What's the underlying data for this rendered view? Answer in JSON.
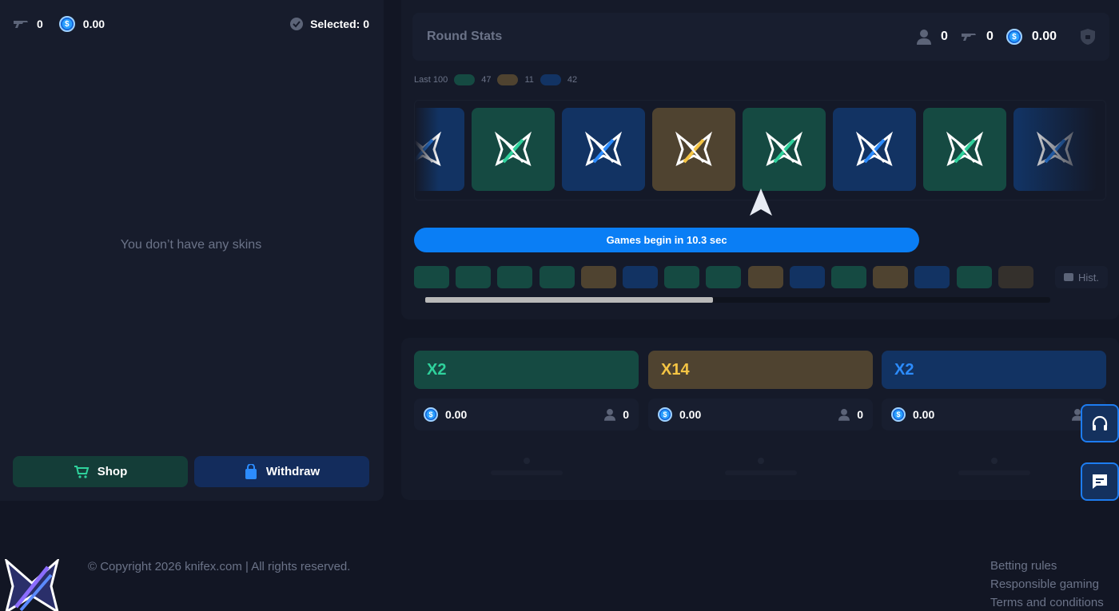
{
  "inventory": {
    "skins_count": "0",
    "balance": "0.00",
    "selected_label": "Selected: 0",
    "empty_message": "You don’t have any skins",
    "shop_label": "Shop",
    "withdraw_label": "Withdraw"
  },
  "round_stats": {
    "title": "Round Stats",
    "players": "0",
    "skins": "0",
    "total": "0.00"
  },
  "last100": {
    "label": "Last 100",
    "green": "47",
    "gold": "11",
    "blue": "42"
  },
  "roulette": {
    "tiles": [
      "blue",
      "green",
      "blue",
      "gold",
      "green",
      "blue",
      "green",
      "blue"
    ]
  },
  "countdown": {
    "text": "Games begin in 10.3 sec",
    "progress_percent": 73
  },
  "history": {
    "chips": [
      "green",
      "green",
      "green",
      "green",
      "gold",
      "blue",
      "green",
      "green",
      "gold",
      "blue",
      "green",
      "gold",
      "blue",
      "green",
      "gold"
    ],
    "button_label": "Hist."
  },
  "bets": [
    {
      "multiplier": "X2",
      "amount": "0.00",
      "players": "0",
      "color": "green"
    },
    {
      "multiplier": "X14",
      "amount": "0.00",
      "players": "0",
      "color": "gold"
    },
    {
      "multiplier": "X2",
      "amount": "0.00",
      "players": "0",
      "color": "blue"
    }
  ],
  "footer": {
    "copyright": "© Copyright 2026 knifex.com | All rights reserved.",
    "links": [
      "Betting rules",
      "Responsible gaming",
      "Terms and conditions"
    ]
  },
  "colors": {
    "green": "#154a42",
    "gold": "#4f4330",
    "blue": "#123363",
    "green_text": "#2fd29c",
    "gold_text": "#f5c544",
    "blue_text": "#2c8cff",
    "accent": "#0a7ef5"
  },
  "icons": [
    "gun-icon",
    "coin-icon",
    "skin-select-icon",
    "user-icon",
    "shield-icon",
    "cart-icon",
    "bag-icon",
    "knife-emblem-icon",
    "pointer-icon",
    "headset-icon",
    "chat-icon",
    "history-icon"
  ]
}
